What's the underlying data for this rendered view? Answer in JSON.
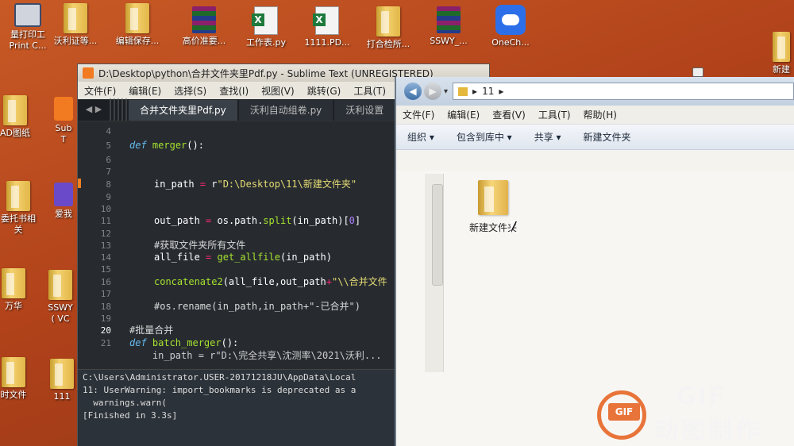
{
  "desktop": {
    "icons": [
      {
        "label": "量打印工",
        "label2": "Print C...",
        "icon": "printer-icon"
      },
      {
        "label": "沃利证等...",
        "icon": "folder-icon"
      },
      {
        "label": "编辑保存...",
        "icon": "folder-icon"
      },
      {
        "label": "高价准要...",
        "icon": "winrar-icon"
      },
      {
        "label": "工作表.py",
        "icon": "excel-icon"
      },
      {
        "label": "1111.PD...",
        "icon": "excel-icon"
      },
      {
        "label": "打合检所...",
        "icon": "folder-icon"
      },
      {
        "label": "SSWY_...",
        "icon": "winrar-icon"
      },
      {
        "label": "OneCh...",
        "icon": "cloud-icon"
      },
      {
        "label": "AD图纸",
        "icon": "folder-icon"
      },
      {
        "label": "Sub",
        "label2": "T",
        "icon": "sublime-icon"
      },
      {
        "label": "委托书相",
        "label2": "关",
        "icon": "folder-icon"
      },
      {
        "label": "爱我",
        "icon": "app-icon"
      },
      {
        "label": "万华",
        "icon": "folder-icon"
      },
      {
        "label": "SSWY",
        "label2": "( VC",
        "icon": "folder-icon"
      },
      {
        "label": "时文件",
        "icon": "folder-icon"
      },
      {
        "label": "111",
        "icon": "folder-icon"
      },
      {
        "label": "新建",
        "icon": "folder-icon"
      }
    ]
  },
  "sublime": {
    "title": "D:\\Desktop\\python\\合并文件夹里Pdf.py - Sublime Text (UNREGISTERED)",
    "menu": [
      "文件(F)",
      "编辑(E)",
      "选择(S)",
      "查找(I)",
      "视图(V)",
      "跳转(G)",
      "工具(T)"
    ],
    "nav_arrows": "◀ ▶",
    "tabs": [
      {
        "label": "合并文件夹里Pdf.py",
        "active": true
      },
      {
        "label": "沃利自动组卷.py",
        "active": false
      },
      {
        "label": "沃利设置",
        "active": false
      }
    ],
    "code": {
      "line_numbers": [
        "4",
        "5",
        "6",
        "7",
        "8",
        "9",
        "10",
        "11",
        "12",
        "13",
        "14",
        "15",
        "16",
        "17",
        "18",
        "19",
        "20",
        "21"
      ],
      "line5": {
        "kw": "def",
        "fn": "merger",
        "rest": "():"
      },
      "line8": {
        "a": "in_path ",
        "op": "=",
        "b": " r",
        "str": "\"D:\\Desktop\\11\\新建文件夹\""
      },
      "line11": {
        "a": "out_path ",
        "op": "=",
        "b": " os.path.",
        "fn": "split",
        "c": "(in_path)[",
        "num": "0",
        "d": "]"
      },
      "line13": "#获取文件夹所有文件",
      "line14": {
        "a": "all_file ",
        "op": "=",
        "fn": " get_allfile",
        "b": "(in_path)"
      },
      "line16": {
        "fn": "concatenate2",
        "a": "(all_file,out_path",
        "op": "+",
        "str": "\"\\\\合并文件"
      },
      "line18": "#os.rename(in_path,in_path+\"-已合并\")",
      "line20": "#批量合并",
      "line21": {
        "kw": "def",
        "fn": " batch_merger",
        "rest": "():"
      },
      "line22": "    in_path = r\"D:\\完全共享\\沈测率\\2021\\沃利..."
    },
    "console": [
      "C:\\Users\\Administrator.USER-20171218JU\\AppData\\Local",
      "11: UserWarning: import_bookmarks is deprecated as a",
      "  warnings.warn(",
      "[Finished in 3.3s]"
    ]
  },
  "explorer": {
    "breadcrumb": "11",
    "breadcrumb_sep": "▸",
    "menu": [
      "文件(F)",
      "编辑(E)",
      "查看(V)",
      "工具(T)",
      "帮助(H)"
    ],
    "toolbar": [
      "组织 ▾",
      "包含到库中 ▾",
      "共享 ▾",
      "新建文件夹"
    ],
    "items": [
      {
        "label": "新建文件夹",
        "icon": "folder-icon"
      }
    ]
  },
  "watermark": {
    "logo": "GIF",
    "brand": "GIF",
    "brand_cn": "动图制作"
  },
  "colors": {
    "desktop_bg": "#b1421a",
    "editor_bg": "#272b30",
    "keyword": "#66bbee",
    "function": "#a6e22e",
    "string": "#e6db74",
    "operator": "#f92672",
    "number": "#ae81ff",
    "watermark_accent": "#e8743a"
  }
}
